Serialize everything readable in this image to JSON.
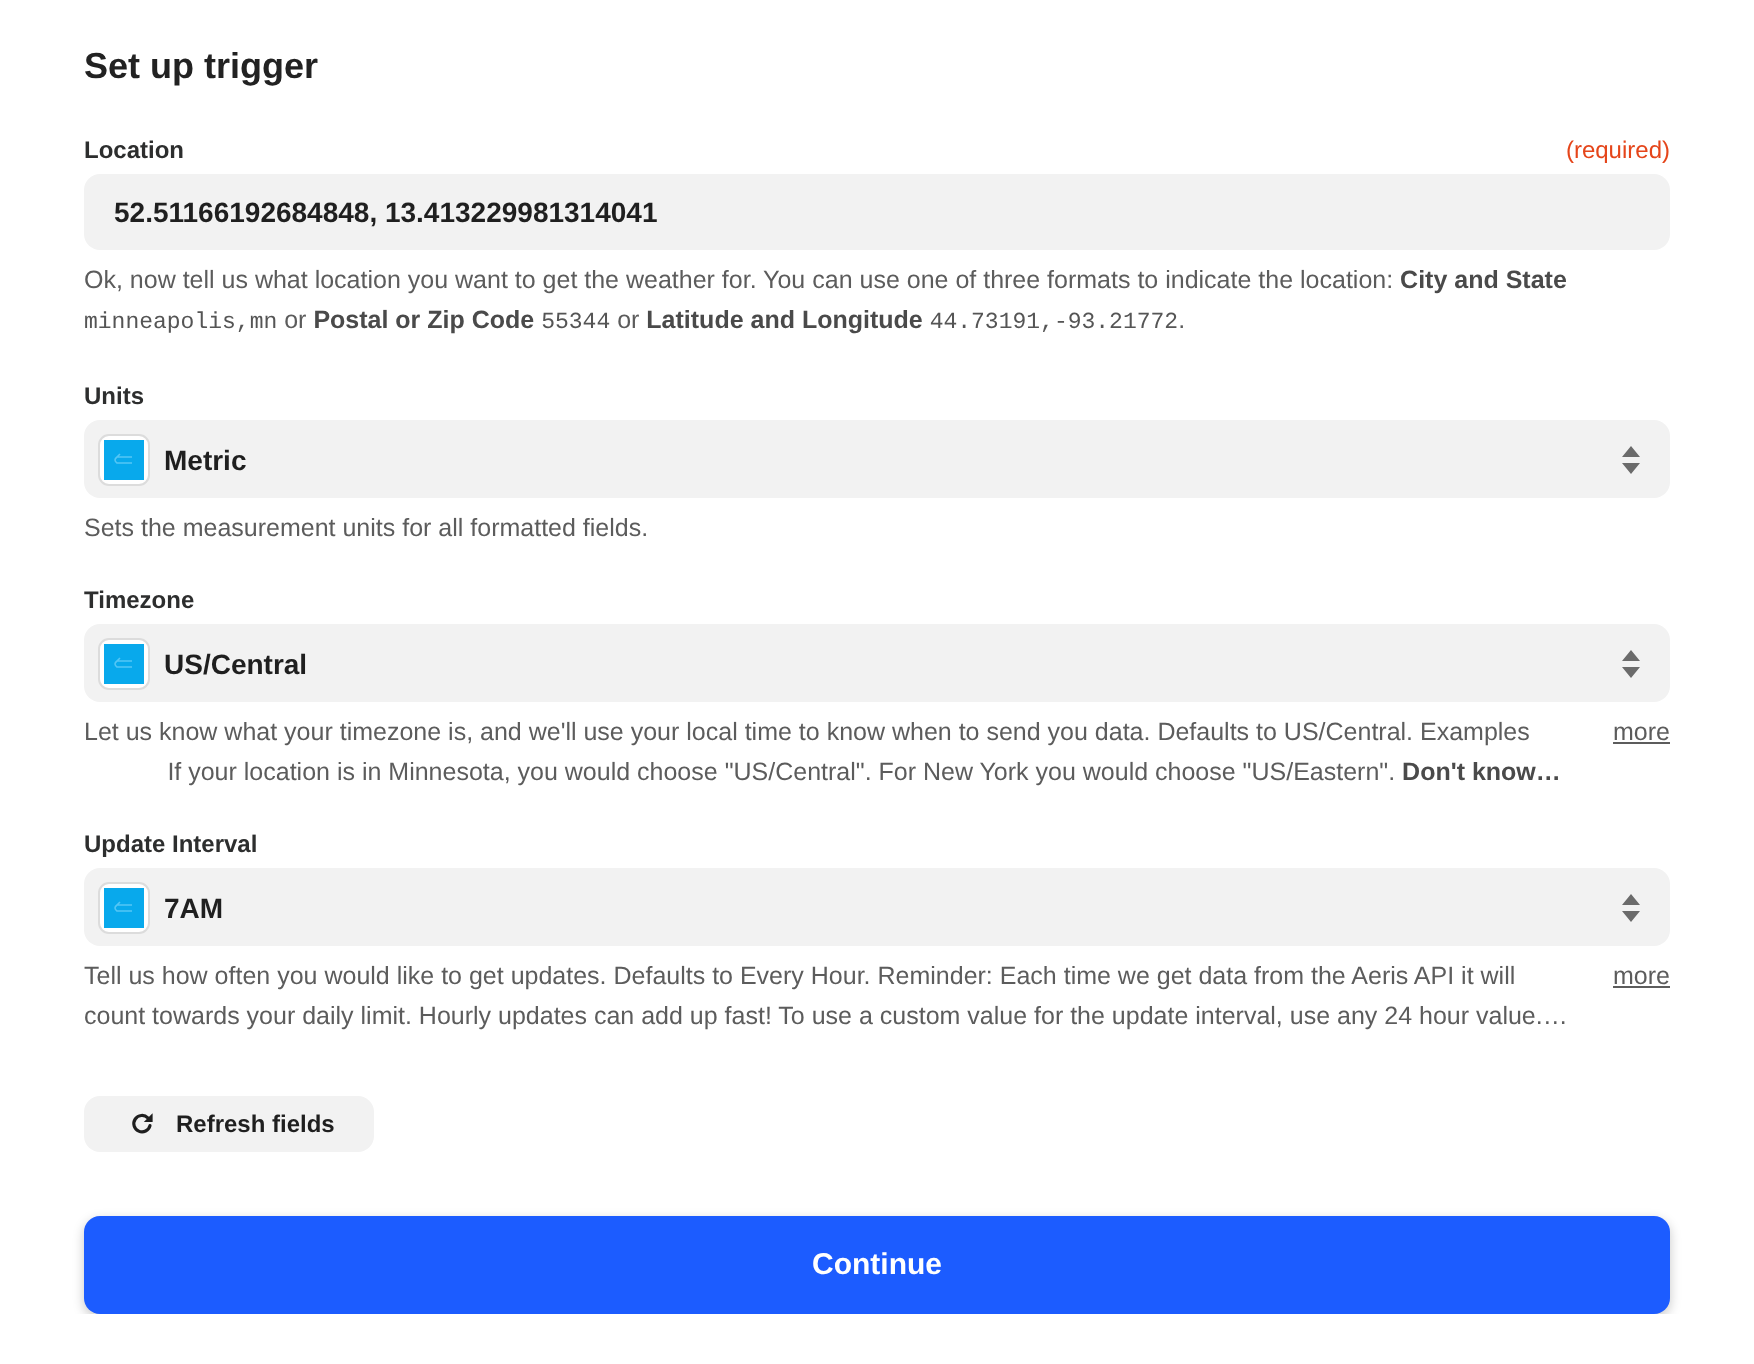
{
  "title": "Set up trigger",
  "fields": [
    {
      "kind": "text",
      "label": "Location",
      "required_note": "(required)",
      "value": "52.51166192684848, 13.413229981314041",
      "help": [
        {
          "kind": "plain",
          "text": "Ok, now tell us what location you want to get the weather for. You can use one of three formats to indicate the location: "
        },
        {
          "kind": "bold",
          "text": "City and State "
        },
        {
          "kind": "code",
          "text": "minneapolis,mn"
        },
        {
          "kind": "plain",
          "text": " or "
        },
        {
          "kind": "bold",
          "text": "Postal or Zip Code "
        },
        {
          "kind": "code",
          "text": "55344"
        },
        {
          "kind": "plain",
          "text": " or "
        },
        {
          "kind": "bold",
          "text": "Latitude and Longitude "
        },
        {
          "kind": "code",
          "text": "44.73191,-93.21772"
        },
        {
          "kind": "plain",
          "text": "."
        }
      ]
    },
    {
      "kind": "select",
      "label": "Units",
      "value": "Metric",
      "help": [
        {
          "kind": "plain",
          "text": "Sets the measurement units for all formatted fields."
        }
      ]
    },
    {
      "kind": "select",
      "label": "Timezone",
      "value": "US/Central",
      "help": [
        {
          "kind": "plain",
          "text": "Let us know what your timezone is, and we'll use your local time to know when to send you data. Defaults to US/Central. Examples\n            If your location is in Minnesota, you would choose \"US/Central\". For New York you would choose \"US/Eastern\". "
        },
        {
          "kind": "bold",
          "text": "Don't know…"
        }
      ],
      "more_link": "more"
    },
    {
      "kind": "select",
      "label": "Update Interval",
      "value": "7AM",
      "help": [
        {
          "kind": "plain",
          "text": "Tell us how often you would like to get updates. Defaults to Every Hour. Reminder: Each time we get data from the Aeris API it will count towards your daily limit. Hourly updates can add up fast! To use a custom value for the update interval, use any 24 hour value.…"
        }
      ],
      "more_link": "more"
    }
  ],
  "refresh_button": {
    "label": "Refresh fields"
  },
  "continue_button": {
    "label": "Continue"
  }
}
